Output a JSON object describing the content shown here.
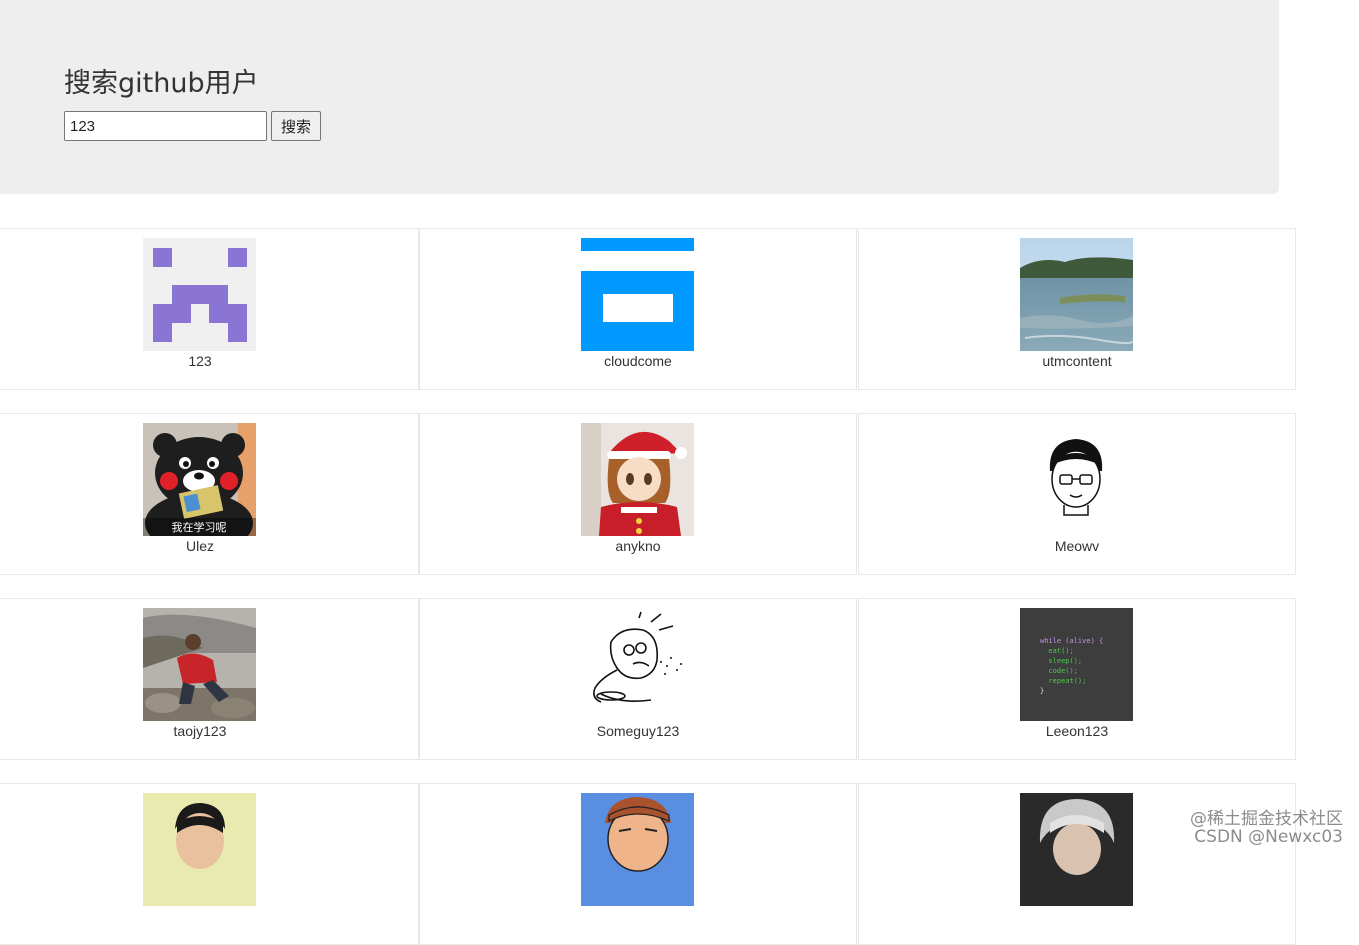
{
  "header": {
    "title": "搜索github用户",
    "search_value": "123",
    "search_button": "搜索"
  },
  "users": [
    {
      "login": "123",
      "avatar": "purple-identicon"
    },
    {
      "login": "cloudcome",
      "avatar": "blue-g-logo"
    },
    {
      "login": "utmcontent",
      "avatar": "lake-landscape-photo"
    },
    {
      "login": "Ulez",
      "avatar": "kumamon-bear-reading",
      "avatar_caption": "我在学习呢"
    },
    {
      "login": "anykno",
      "avatar": "anime-girl-santa-hat"
    },
    {
      "login": "Meowv",
      "avatar": "cartoon-boy-glasses"
    },
    {
      "login": "taojy123",
      "avatar": "man-red-jacket-photo"
    },
    {
      "login": "Someguy123",
      "avatar": "cereal-guy-meme"
    },
    {
      "login": "Leeon123",
      "avatar": "code-snippet-dark"
    },
    {
      "login": "",
      "avatar": "young-man-photo"
    },
    {
      "login": "",
      "avatar": "comic-man-face"
    },
    {
      "login": "",
      "avatar": "silver-hair-avatar"
    }
  ],
  "code_lines": [
    "while (alive) {",
    "  eat();",
    "  sleep();",
    "  code();",
    "  repeat();",
    "}"
  ],
  "watermark": {
    "line1": "@稀土掘金技术社区",
    "line2": "CSDN @Newxc03"
  },
  "colors": {
    "jumbotron_bg": "#eeeeee",
    "identicon_purple": "#8a74d4",
    "brand_blue": "#0099ff"
  }
}
